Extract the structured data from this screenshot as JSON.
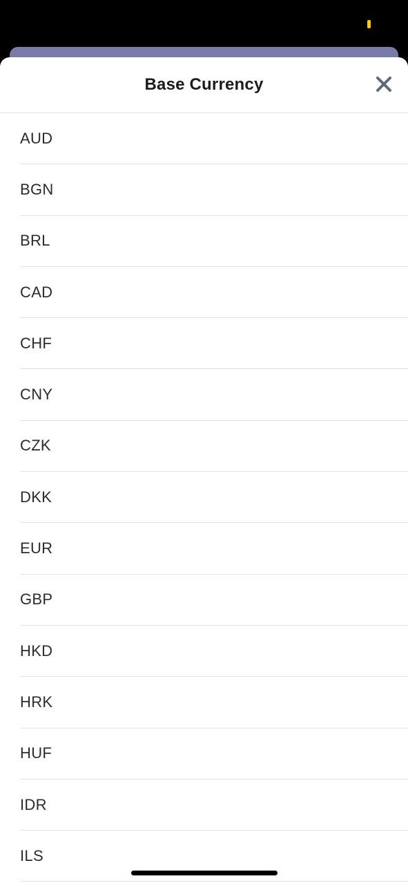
{
  "status_bar": {
    "indicator_color": "#FFCC00"
  },
  "underlay": {
    "color": "#7B7BA8"
  },
  "sheet": {
    "title": "Base Currency",
    "close_icon": "close-icon",
    "close_icon_color": "#5B6B78"
  },
  "currencies": [
    {
      "label": "AUD"
    },
    {
      "label": "BGN"
    },
    {
      "label": "BRL"
    },
    {
      "label": "CAD"
    },
    {
      "label": "CHF"
    },
    {
      "label": "CNY"
    },
    {
      "label": "CZK"
    },
    {
      "label": "DKK"
    },
    {
      "label": "EUR"
    },
    {
      "label": "GBP"
    },
    {
      "label": "HKD"
    },
    {
      "label": "HRK"
    },
    {
      "label": "HUF"
    },
    {
      "label": "IDR"
    },
    {
      "label": "ILS"
    }
  ]
}
